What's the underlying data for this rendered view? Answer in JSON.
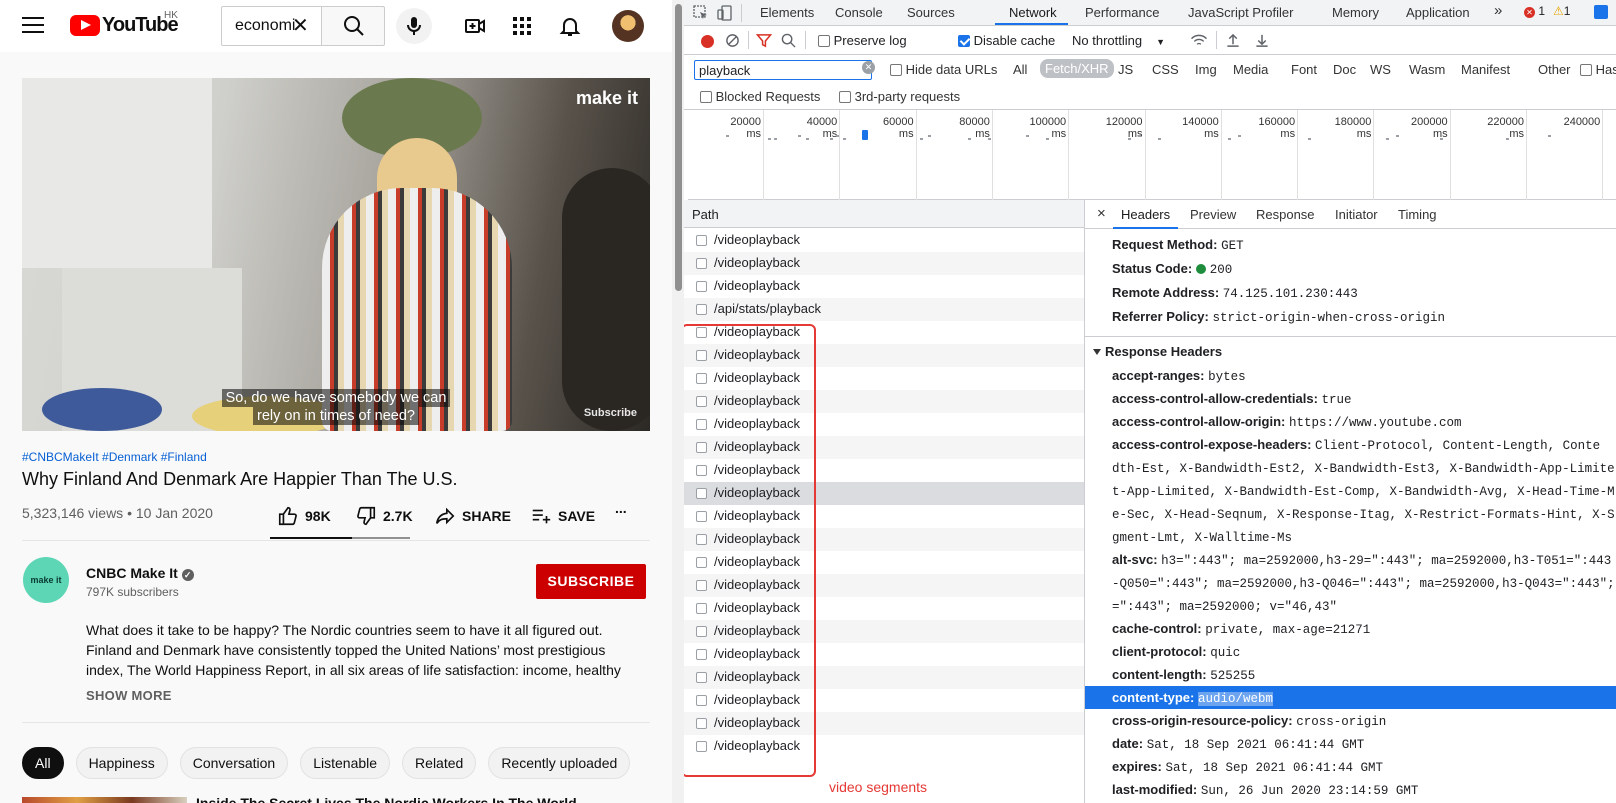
{
  "youtube": {
    "logo_text": "YouTube",
    "country_code": "HK",
    "search_value": "economi",
    "video": {
      "watermark": "make it",
      "subtitle_line1": "So, do we have somebody we can",
      "subtitle_line2": "rely on in times of need?",
      "subscribe_overlay": "Subscribe"
    },
    "hashtags": "#CNBCMakeIt #Denmark #Finland",
    "title": "Why Finland And Denmark Are Happier Than The U.S.",
    "views_date": "5,323,146 views • 10 Jan 2020",
    "likes": "98K",
    "dislikes": "2.7K",
    "share_label": "SHARE",
    "save_label": "SAVE",
    "more_label": "...",
    "channel": {
      "avatar_text": "make it",
      "name": "CNBC Make It",
      "subscribers": "797K subscribers",
      "subscribe_label": "SUBSCRIBE"
    },
    "description": "What does it take to be happy? The Nordic countries seem to have it all figured out. Finland and Denmark have consistently topped the United Nations’ most prestigious index, The World Happiness Report, in all six areas of life satisfaction: income, healthy",
    "show_more": "SHOW MORE",
    "chips": [
      "All",
      "Happiness",
      "Conversation",
      "Listenable",
      "Related",
      "Recently uploaded"
    ],
    "next_video_title": "Inside The Secret Lives The Nordic Workers In The World "
  },
  "devtools": {
    "tabs": [
      "Elements",
      "Console",
      "Sources",
      "Network",
      "Performance",
      "JavaScript Profiler",
      "Memory",
      "Application"
    ],
    "active_tab": "Network",
    "more_tabs": "»",
    "error_count": "1",
    "warning_count": "1",
    "toolbar": {
      "preserve_log": "Preserve log",
      "disable_cache": "Disable cache",
      "throttling": "No throttling"
    },
    "filter": {
      "value": "playback",
      "hide_data_urls": "Hide data URLs",
      "types": [
        "All",
        "Fetch/XHR",
        "JS",
        "CSS",
        "Img",
        "Media",
        "Font",
        "Doc",
        "WS",
        "Wasm",
        "Manifest",
        "Other"
      ],
      "active_type": "Fetch/XHR",
      "has_blocked": "Has blocked",
      "blocked_requests": "Blocked Requests",
      "third_party": "3rd-party requests"
    },
    "timeline_labels": [
      "20000 ms",
      "40000 ms",
      "60000 ms",
      "80000 ms",
      "100000 ms",
      "120000 ms",
      "140000 ms",
      "160000 ms",
      "180000 ms",
      "200000 ms",
      "220000 ms",
      "240000"
    ],
    "path_header": "Path",
    "rows": [
      "/videoplayback",
      "/videoplayback",
      "/videoplayback",
      "/api/stats/playback",
      "/videoplayback",
      "/videoplayback",
      "/videoplayback",
      "/videoplayback",
      "/videoplayback",
      "/videoplayback",
      "/videoplayback",
      "/videoplayback",
      "/videoplayback",
      "/videoplayback",
      "/videoplayback",
      "/videoplayback",
      "/videoplayback",
      "/videoplayback",
      "/videoplayback",
      "/videoplayback",
      "/videoplayback",
      "/videoplayback",
      "/videoplayback"
    ],
    "annotation": "video segments",
    "detail_tabs": [
      "Headers",
      "Preview",
      "Response",
      "Initiator",
      "Timing"
    ],
    "general": [
      {
        "k": "Request Method:",
        "v": "GET"
      },
      {
        "k": "Status Code:",
        "v": "200"
      },
      {
        "k": "Remote Address:",
        "v": "74.125.101.230:443"
      },
      {
        "k": "Referrer Policy:",
        "v": "strict-origin-when-cross-origin"
      }
    ],
    "response_headers_title": "Response Headers",
    "headers": [
      {
        "k": "accept-ranges:",
        "v": "bytes"
      },
      {
        "k": "access-control-allow-credentials:",
        "v": "true"
      },
      {
        "k": "access-control-allow-origin:",
        "v": "https://www.youtube.com"
      },
      {
        "k": "access-control-expose-headers:",
        "v": "Client-Protocol, Content-Length, Conte"
      },
      {
        "k": "",
        "v": "dth-Est, X-Bandwidth-Est2, X-Bandwidth-Est3, X-Bandwidth-App-Limite"
      },
      {
        "k": "",
        "v": "t-App-Limited, X-Bandwidth-Est-Comp, X-Bandwidth-Avg, X-Head-Time-M"
      },
      {
        "k": "",
        "v": "e-Sec, X-Head-Seqnum, X-Response-Itag, X-Restrict-Formats-Hint, X-S"
      },
      {
        "k": "",
        "v": "gment-Lmt, X-Walltime-Ms"
      },
      {
        "k": "alt-svc:",
        "v": "h3=\":443\"; ma=2592000,h3-29=\":443\"; ma=2592000,h3-T051=\":443"
      },
      {
        "k": "",
        "v": "-Q050=\":443\"; ma=2592000,h3-Q046=\":443\"; ma=2592000,h3-Q043=\":443\";"
      },
      {
        "k": "",
        "v": "=\":443\"; ma=2592000; v=\"46,43\""
      },
      {
        "k": "cache-control:",
        "v": "private, max-age=21271"
      },
      {
        "k": "client-protocol:",
        "v": "quic"
      },
      {
        "k": "content-length:",
        "v": "525255"
      },
      {
        "k": "content-type:",
        "v": "audio/webm"
      },
      {
        "k": "cross-origin-resource-policy:",
        "v": "cross-origin"
      },
      {
        "k": "date:",
        "v": "Sat, 18 Sep 2021 06:41:44 GMT"
      },
      {
        "k": "expires:",
        "v": "Sat, 18 Sep 2021 06:41:44 GMT"
      },
      {
        "k": "last-modified:",
        "v": "Sun, 26 Jun 2020 23:14:59 GMT"
      }
    ]
  }
}
